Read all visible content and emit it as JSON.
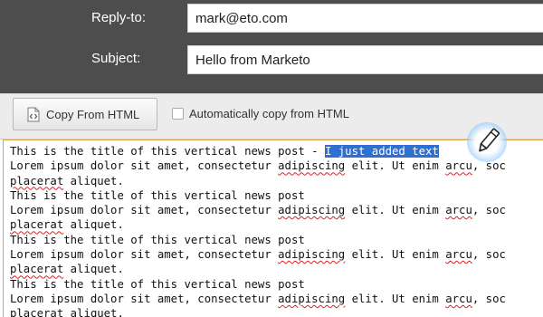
{
  "header": {
    "reply_to": {
      "label": "Reply-to:",
      "value": "mark@eto.com"
    },
    "subject": {
      "label": "Subject:",
      "value": "Hello from Marketo"
    }
  },
  "toolbar": {
    "copy_button_label": "Copy From HTML",
    "copy_button_icon": "html-code-icon",
    "auto_copy": {
      "label": "Automatically copy from HTML",
      "checked": false
    }
  },
  "editor": {
    "first_title_prefix": "This is the title of this vertical news post - ",
    "first_title_selected": "I just added text",
    "title": "This is the title of this vertical news post",
    "body_before": "Lorem ipsum dolor sit amet, consectetur ",
    "body_spell_1": "adipiscing",
    "body_middle": " elit. Ut enim ",
    "body_spell_2": "arcu",
    "body_after": ", soc",
    "body_wrap_spell": "placerat",
    "body_wrap_end": " aliquet.",
    "blocks": [
      {
        "kind": "first"
      },
      {
        "kind": "normal"
      },
      {
        "kind": "normal"
      },
      {
        "kind": "normal"
      }
    ],
    "cursor_icon": "pencil-icon",
    "accent_color": "#d9a441",
    "selection_color": "#2f6fd1"
  }
}
